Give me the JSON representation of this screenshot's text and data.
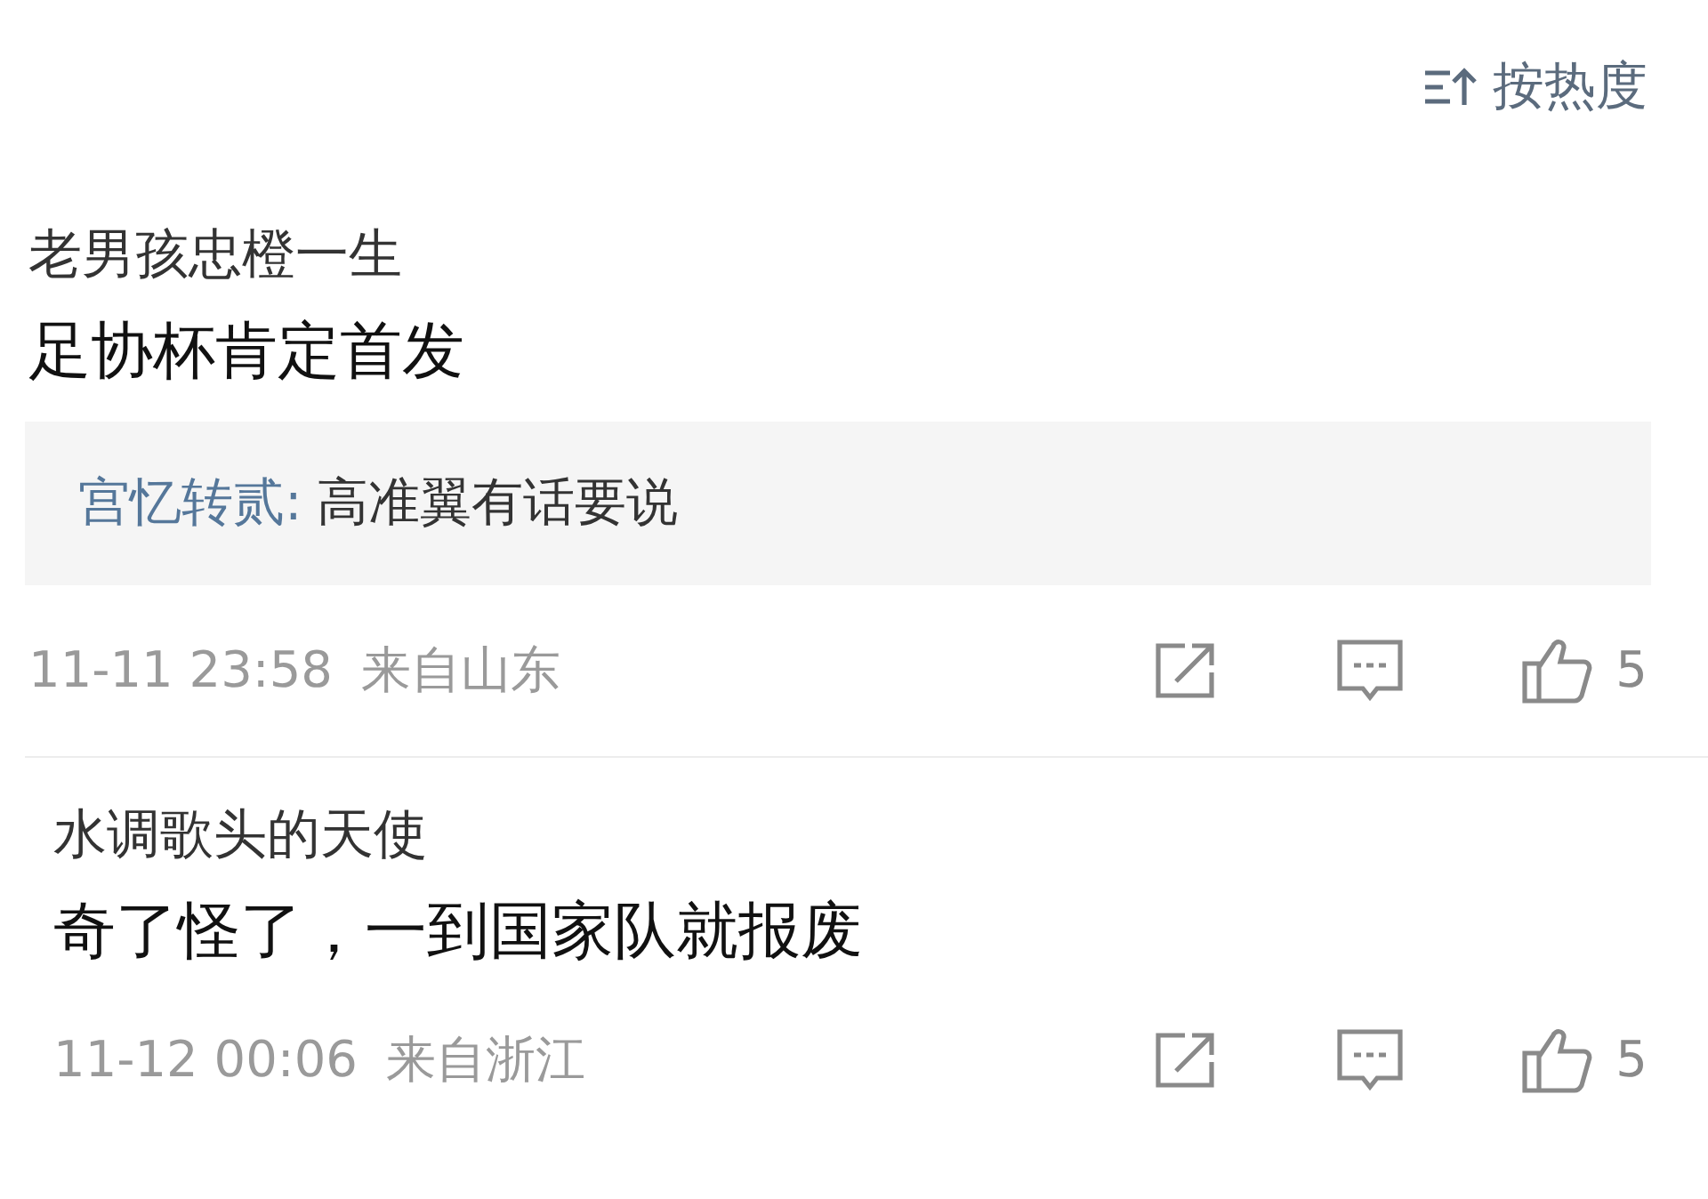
{
  "sort": {
    "label": "按热度"
  },
  "comments": [
    {
      "user": "老男孩忠橙一生",
      "text": "足协杯肯定首发",
      "reply": {
        "author": "宫忆转贰:",
        "text": "高准翼有话要说"
      },
      "time": "11-11 23:58",
      "location": "来自山东",
      "likes": "5"
    },
    {
      "user": "水调歌头的天使",
      "text": "奇了怪了，一到国家队就报废",
      "time": "11-12 00:06",
      "location": "来自浙江",
      "likes": "5"
    }
  ]
}
